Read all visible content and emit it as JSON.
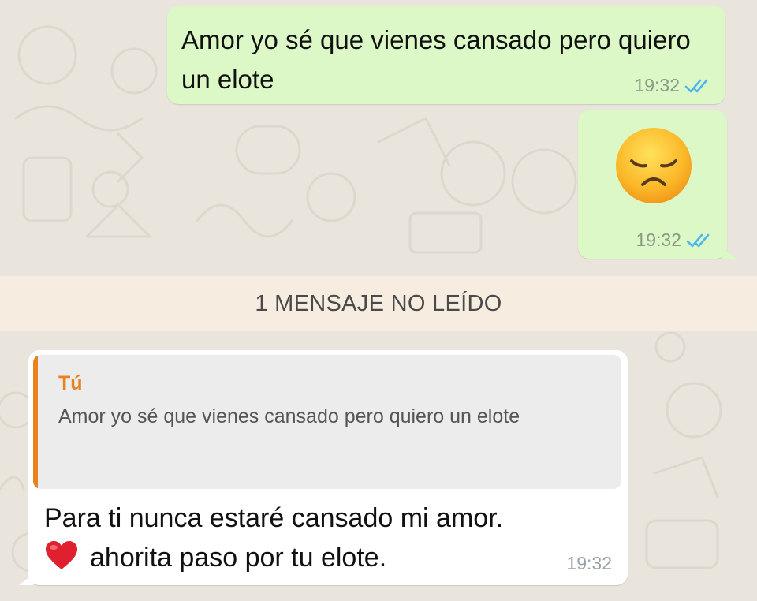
{
  "colors": {
    "outgoing_bubble": "#dcf8c6",
    "incoming_bubble": "#ffffff",
    "chat_background": "#e9e5dd",
    "quote_accent": "#e8821e",
    "read_ticks": "#4fb6ec"
  },
  "messages": [
    {
      "direction": "outgoing",
      "text": "Amor yo sé que vienes cansado pero quiero un elote",
      "time": "19:32",
      "status_icon": "double-check-read-icon"
    },
    {
      "direction": "outgoing",
      "emoji": "disappointed-face-emoji",
      "time": "19:32",
      "status_icon": "double-check-read-icon"
    }
  ],
  "unread_divider": "1 MENSAJE NO LEÍDO",
  "reply_message": {
    "direction": "incoming",
    "quote": {
      "author": "Tú",
      "text": "Amor yo sé que vienes cansado pero quiero un elote"
    },
    "line1": "Para ti nunca estaré cansado mi amor.",
    "line2_emoji": "red-heart-emoji",
    "line2": "ahorita paso por tu elote.",
    "time": "19:32"
  }
}
